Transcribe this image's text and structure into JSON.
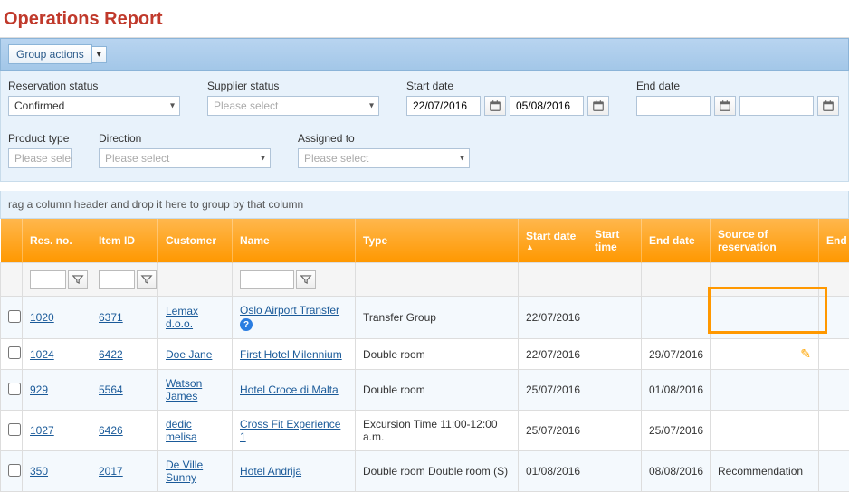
{
  "title": "Operations Report",
  "toolbar": {
    "group_actions": "Group actions"
  },
  "filters": {
    "reservation_status": {
      "label": "Reservation status",
      "value": "Confirmed"
    },
    "supplier_status": {
      "label": "Supplier status",
      "value": "Please select"
    },
    "start_date": {
      "label": "Start date",
      "from": "22/07/2016",
      "to": "05/08/2016"
    },
    "end_date": {
      "label": "End date",
      "from": "",
      "to": ""
    },
    "product_type": {
      "label": "Product type",
      "value": "Please selec"
    },
    "direction": {
      "label": "Direction",
      "value": "Please select"
    },
    "assigned_to": {
      "label": "Assigned to",
      "value": "Please select"
    }
  },
  "group_hint": "rag a column header and drop it here to group by that column",
  "columns": {
    "res_no": "Res. no.",
    "item_id": "Item ID",
    "customer": "Customer",
    "name": "Name",
    "type": "Type",
    "start_date": "Start date",
    "start_time": "Start time",
    "end_date": "End date",
    "source": "Source of reservation",
    "end": "End"
  },
  "rows": [
    {
      "res_no": "1020",
      "item_id": "6371",
      "customer": "Lemax d.o.o.",
      "name": "Oslo Airport Transfer",
      "name_info": true,
      "type": "Transfer Group",
      "start_date": "22/07/2016",
      "start_time": "",
      "end_date": "",
      "source": ""
    },
    {
      "res_no": "1024",
      "item_id": "6422",
      "customer": "Doe Jane",
      "name": "First Hotel Milennium",
      "type": "Double room",
      "start_date": "22/07/2016",
      "start_time": "",
      "end_date": "29/07/2016",
      "source": "",
      "pencil": true
    },
    {
      "res_no": "929",
      "item_id": "5564",
      "customer": "Watson James",
      "name": "Hotel Croce di Malta",
      "type": "Double room",
      "start_date": "25/07/2016",
      "start_time": "",
      "end_date": "01/08/2016",
      "source": ""
    },
    {
      "res_no": "1027",
      "item_id": "6426",
      "customer": "dedic melisa",
      "name": "Cross Fit Experience 1",
      "type": "Excursion Time 11:00-12:00 a.m.",
      "start_date": "25/07/2016",
      "start_time": "",
      "end_date": "25/07/2016",
      "source": ""
    },
    {
      "res_no": "350",
      "item_id": "2017",
      "customer": "De Ville Sunny",
      "name": "Hotel Andrija",
      "type": "Double room Double room (S)",
      "start_date": "01/08/2016",
      "start_time": "",
      "end_date": "08/08/2016",
      "source": "Recommendation"
    }
  ]
}
